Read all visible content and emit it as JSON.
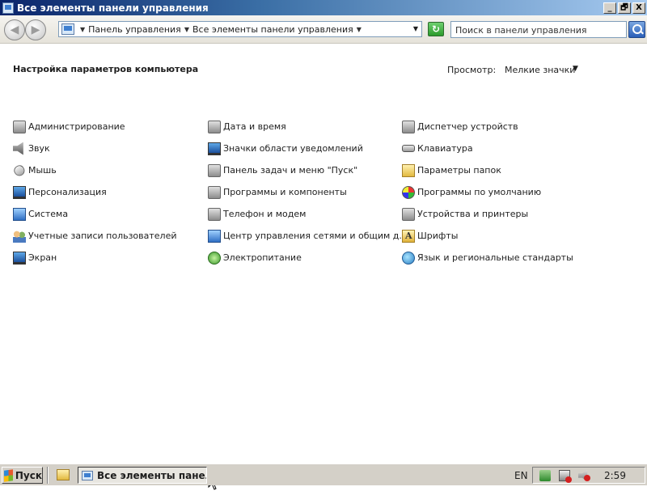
{
  "window": {
    "title": "Все элементы панели управления",
    "caption_buttons": [
      "_",
      "🗗",
      "X"
    ]
  },
  "navbar": {
    "breadcrumbs": [
      "Панель управления",
      "Все элементы панели управления"
    ],
    "search_placeholder": "Поиск в панели управления"
  },
  "content": {
    "page_title": "Настройка параметров компьютера",
    "view_label": "Просмотр:",
    "view_value": "Мелкие значки",
    "columns": [
      [
        {
          "label": "Администрирование",
          "icon": "admin-tools-icon"
        },
        {
          "label": "Звук",
          "icon": "speaker-icon"
        },
        {
          "label": "Мышь",
          "icon": "mouse-icon"
        },
        {
          "label": "Персонализация",
          "icon": "personalization-icon"
        },
        {
          "label": "Система",
          "icon": "system-icon"
        },
        {
          "label": "Учетные записи пользователей",
          "icon": "users-icon"
        },
        {
          "label": "Экран",
          "icon": "display-icon"
        }
      ],
      [
        {
          "label": "Дата и время",
          "icon": "calendar-icon"
        },
        {
          "label": "Значки области уведомлений",
          "icon": "notification-area-icon"
        },
        {
          "label": "Панель задач и меню \"Пуск\"",
          "icon": "taskbar-icon"
        },
        {
          "label": "Программы и компоненты",
          "icon": "programs-icon"
        },
        {
          "label": "Телефон и модем",
          "icon": "phone-modem-icon"
        },
        {
          "label": "Центр управления сетями и общим д...",
          "icon": "network-center-icon"
        },
        {
          "label": "Электропитание",
          "icon": "power-options-icon"
        }
      ],
      [
        {
          "label": "Диспетчер устройств",
          "icon": "device-manager-icon"
        },
        {
          "label": "Клавиатура",
          "icon": "keyboard-icon"
        },
        {
          "label": "Параметры папок",
          "icon": "folder-options-icon"
        },
        {
          "label": "Программы по умолчанию",
          "icon": "default-programs-icon"
        },
        {
          "label": "Устройства и принтеры",
          "icon": "devices-printers-icon"
        },
        {
          "label": "Шрифты",
          "icon": "fonts-icon"
        },
        {
          "label": "Язык и региональные стандарты",
          "icon": "region-language-icon"
        }
      ]
    ]
  },
  "taskbar": {
    "start_label": "Пуск",
    "task_label": "Все элементы панел...",
    "lang": "EN",
    "clock": "2:59"
  }
}
